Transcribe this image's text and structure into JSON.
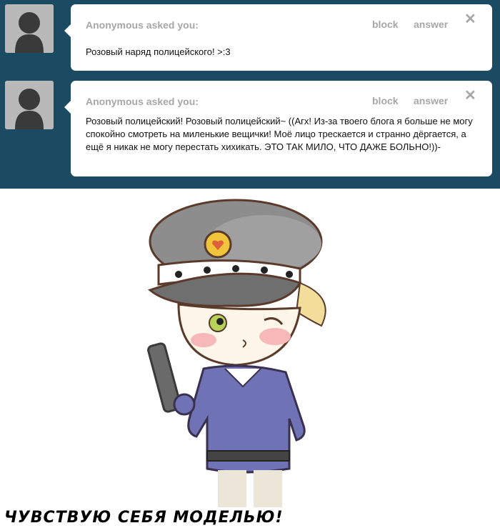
{
  "posts": [
    {
      "asker": "Anonymous asked you:",
      "block": "block",
      "answer": "answer",
      "close": "✕",
      "question": "Розовый наряд полицейского! >:3"
    },
    {
      "asker": "Anonymous asked you:",
      "block": "block",
      "answer": "answer",
      "close": "✕",
      "question": "Розовый полицейский! Розовый полицейский~ ((Агх! Из-за твоего блога я больше не могу спокойно смотреть на миленькие вещички! Моё лицо трескается и странно дёргается, а ещё я никак не могу перестать хихикать. ЭТО ТАК МИЛО, ЧТО ДАЖЕ БОЛЬНО!))-"
    }
  ],
  "caption": "Чувствую себя моделью!",
  "colors": {
    "dashboard": "#1a4b63",
    "muted_text": "#a7a7a7",
    "uniform": "#6f73b5",
    "cap": "#8c8c8c"
  },
  "icons": [
    "default-avatar-icon",
    "close-icon"
  ]
}
